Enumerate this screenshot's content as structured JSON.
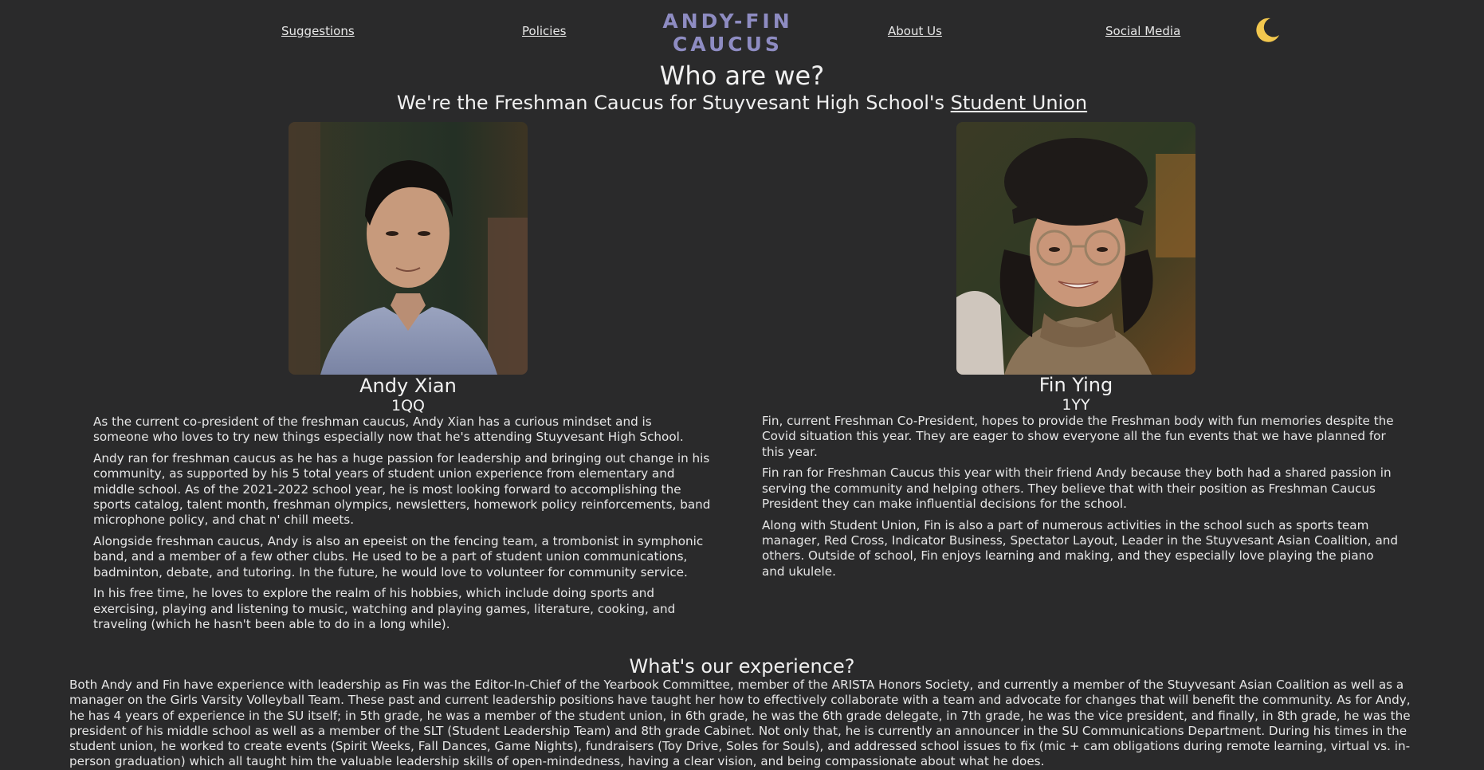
{
  "nav": {
    "suggestions": "Suggestions",
    "policies": "Policies",
    "brand_line1": "ANDY-FIN",
    "brand_line2": "CAUCUS",
    "about": "About Us",
    "social": "Social Media",
    "theme_toggle_icon": "moon-icon"
  },
  "hero": {
    "title": "Who are we?",
    "subtitle_prefix": "We're the Freshman Caucus for Stuyvesant High School's ",
    "subtitle_link": "Student Union"
  },
  "members": {
    "andy": {
      "name": "Andy Xian",
      "room": "1QQ",
      "bio": [
        "As the current co-president of the freshman caucus, Andy Xian has a curious mindset and is someone who loves to try new things especially now that he's attending Stuyvesant High School.",
        "Andy ran for freshman caucus as he has a huge passion for leadership and bringing out change in his community, as supported by his 5 total years of student union experience from elementary and middle school. As of the 2021-2022 school year, he is most looking forward to accomplishing the sports catalog, talent month, freshman olympics, newsletters, homework policy reinforcements, band microphone policy, and chat n' chill meets.",
        "Alongside freshman caucus, Andy is also an epeeist on the fencing team, a trombonist in symphonic band, and a member of a few other clubs. He used to be a part of student union communications, badminton, debate, and tutoring. In the future, he would love to volunteer for community service.",
        "In his free time, he loves to explore the realm of his hobbies, which include doing sports and exercising, playing and listening to music, watching and playing games, literature, cooking, and traveling (which he hasn't been able to do in a long while)."
      ]
    },
    "fin": {
      "name": "Fin Ying",
      "room": "1YY",
      "bio": [
        "Fin, current Freshman Co-President, hopes to provide the Freshman body with fun memories despite the Covid situation this year. They are eager to show everyone all the fun events that we have planned for this year.",
        "Fin ran for Freshman Caucus this year with their friend Andy because they both had a shared passion in serving the community and helping others. They believe that with their position as Freshman Caucus President they can make influential decisions for the school.",
        "Along with Student Union, Fin is also a part of numerous activities in the school such as sports team manager, Red Cross, Indicator Business, Spectator Layout, Leader in the Stuyvesant Asian Coalition, and others. Outside of school, Fin enjoys learning and making, and they especially love playing the piano and ukulele."
      ]
    }
  },
  "experience": {
    "title": "What's our experience?",
    "body": "Both Andy and Fin have experience with leadership as Fin was the Editor-In-Chief of the Yearbook Committee, member of the ARISTA Honors Society, and currently a member of the Stuyvesant Asian Coalition as well as a manager on the Girls Varsity Volleyball Team. These past and current leadership positions have taught her how to effectively collaborate with a team and advocate for changes that will benefit the community. As for Andy, he has 4 years of experience in the SU itself; in 5th grade, he was a member of the student union, in 6th grade, he was the 6th grade delegate, in 7th grade, he was the vice president, and finally, in 8th grade, he was the president of his middle school as well as a member of the SLT (Student Leadership Team) and 8th grade Cabinet. Not only that, he is currently an announcer in the SU Communications Department. During his times in the student union, he worked to create events (Spirit Weeks, Fall Dances, Game Nights), fundraisers (Toy Drive, Soles for Souls), and addressed school issues to fix (mic + cam obligations during remote learning, virtual vs. in-person graduation) which all taught him the valuable leadership skills of open-mindedness, having a clear vision, and being compassionate about what he does."
  },
  "colors": {
    "background": "#2a2a2b",
    "brand": "#8e8cc2",
    "text": "#ececec",
    "moon": "#f2c74e"
  }
}
